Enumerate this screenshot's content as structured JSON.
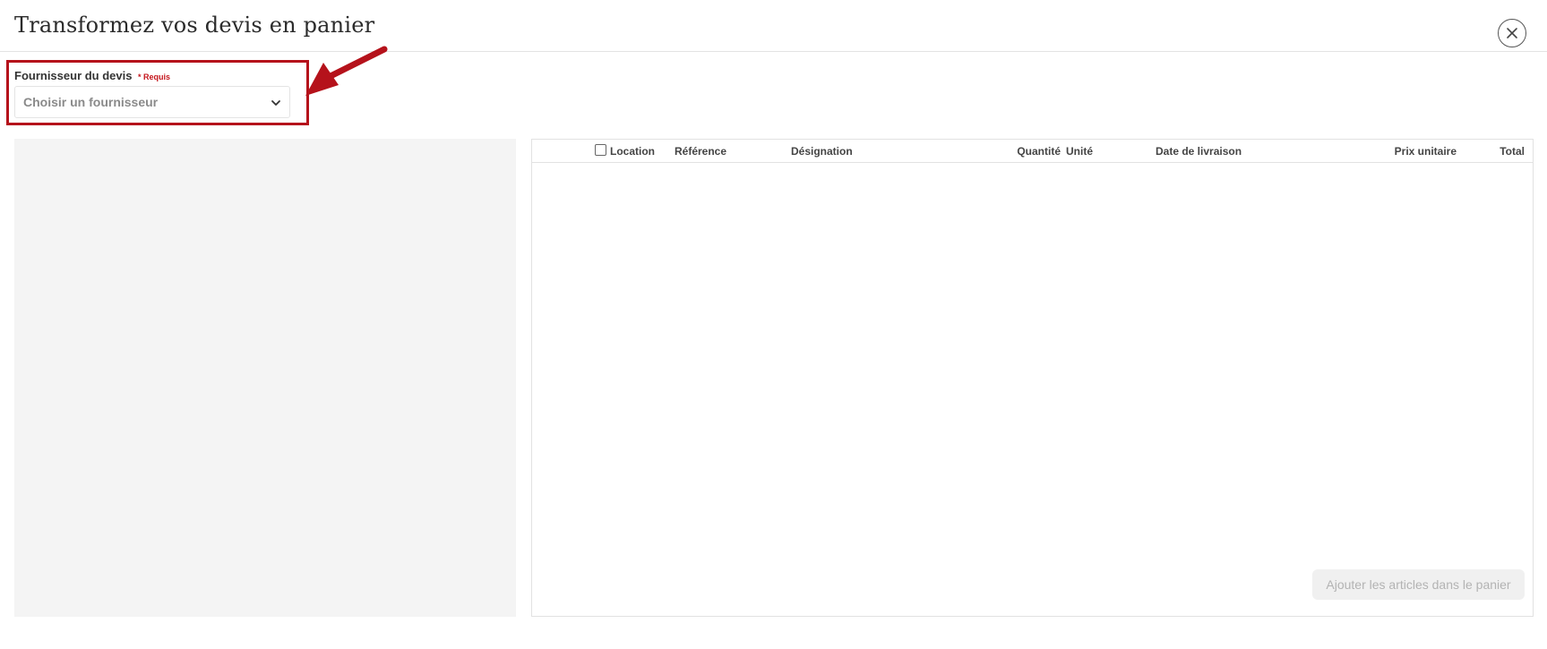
{
  "modal": {
    "title": "Transformez vos devis en panier",
    "close_icon": "close-icon"
  },
  "supplier": {
    "label": "Fournisseur du devis",
    "required": "* Requis",
    "placeholder": "Choisir un fournisseur",
    "dropdown_icon": "chevron-down-icon"
  },
  "annotation": {
    "color": "#b5121b"
  },
  "table": {
    "location_label": "Location",
    "columns": {
      "reference": "Référence",
      "designation": "Désignation",
      "quantity": "Quantité",
      "unit": "Unité",
      "delivery_date": "Date de livraison",
      "unit_price": "Prix unitaire",
      "total": "Total"
    },
    "rows": [],
    "add_button": "Ajouter les articles dans le panier"
  }
}
